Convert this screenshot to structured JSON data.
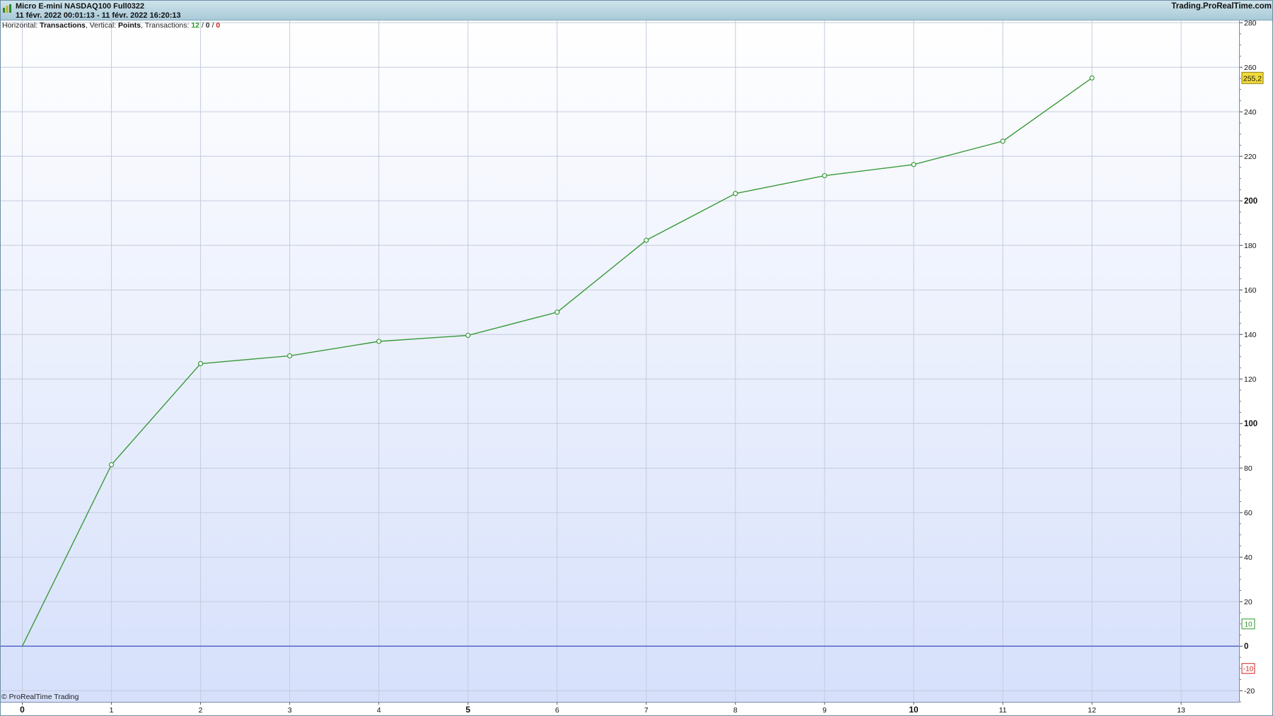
{
  "header": {
    "title": "Micro E-mini NASDAQ100 Full0322",
    "dates": "11 févr. 2022 00:01:13 - 11 févr. 2022 16:20:13",
    "brand": "Trading.ProRealTime.com"
  },
  "info": {
    "horizontal_label": "Horizontal:",
    "horizontal_value": "Transactions",
    "vertical_label": "Vertical:",
    "vertical_value": "Points",
    "transactions_label": "Transactions:",
    "wins": "12",
    "neutral": "0",
    "losses": "0",
    "sep": "/"
  },
  "footer": {
    "copyright": "© ProRealTime Trading"
  },
  "colors": {
    "line": "#3a9a3a",
    "zero_line": "#5566cc",
    "win": "#2a9a2a",
    "loss": "#d02020",
    "marker_fill": "#f2dc3a"
  },
  "chart_data": {
    "type": "line",
    "series": [
      {
        "x": [
          0,
          1,
          2,
          3,
          4,
          5,
          6,
          7,
          8,
          9,
          10,
          11,
          12
        ],
        "values": [
          0,
          81.5,
          126.9,
          130.4,
          136.9,
          139.6,
          150.0,
          182.3,
          203.3,
          211.3,
          216.3,
          226.8,
          255.2
        ]
      }
    ],
    "xlim": [
      -0.25,
      13.65
    ],
    "ylim": [
      -25,
      281
    ],
    "xticks": [
      "0",
      "1",
      "2",
      "3",
      "4",
      "5",
      "6",
      "7",
      "8",
      "9",
      "10",
      "11",
      "12",
      "13"
    ],
    "bold_xticks": [
      "0",
      "5",
      "10"
    ],
    "yticks": [
      "-20",
      "0",
      "20",
      "40",
      "60",
      "80",
      "100",
      "120",
      "140",
      "160",
      "180",
      "200",
      "220",
      "240",
      "260",
      "280"
    ],
    "bold_yticks": [
      "0",
      "100",
      "200"
    ],
    "last_value_label": "255,2",
    "zero_band_labels": {
      "upper": "10",
      "lower": "-10"
    },
    "grid": true
  }
}
